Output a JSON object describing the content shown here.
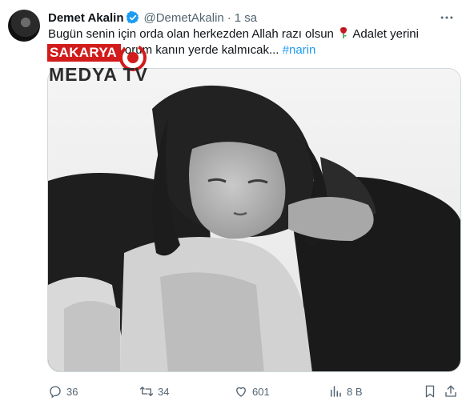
{
  "tweet": {
    "author_name": "Demet Akalin",
    "handle": "@DemetAkalin",
    "separator": "·",
    "time": "1 sa",
    "text_part1": "Bugün senin için orda olan herkezden Allah razı olsun",
    "text_part2": "Adalet yerini",
    "text_part3": "bulacak inanıyorum kanın yerde kalmıcak...",
    "hashtag": "#narin"
  },
  "watermark": {
    "line1": "SAKARYA",
    "line2": "MEDYA TV"
  },
  "actions": {
    "replies": "36",
    "retweets": "34",
    "likes": "601",
    "views": "8 B"
  },
  "colors": {
    "text": "#0f1419",
    "muted": "#536471",
    "link": "#1d9bf0",
    "verified": "#1d9bf0",
    "watermark_red": "#d21b1b"
  },
  "icons": [
    "more-icon",
    "verified-icon",
    "rose-icon",
    "reply-icon",
    "retweet-icon",
    "like-icon",
    "views-icon",
    "bookmark-icon",
    "share-icon"
  ]
}
